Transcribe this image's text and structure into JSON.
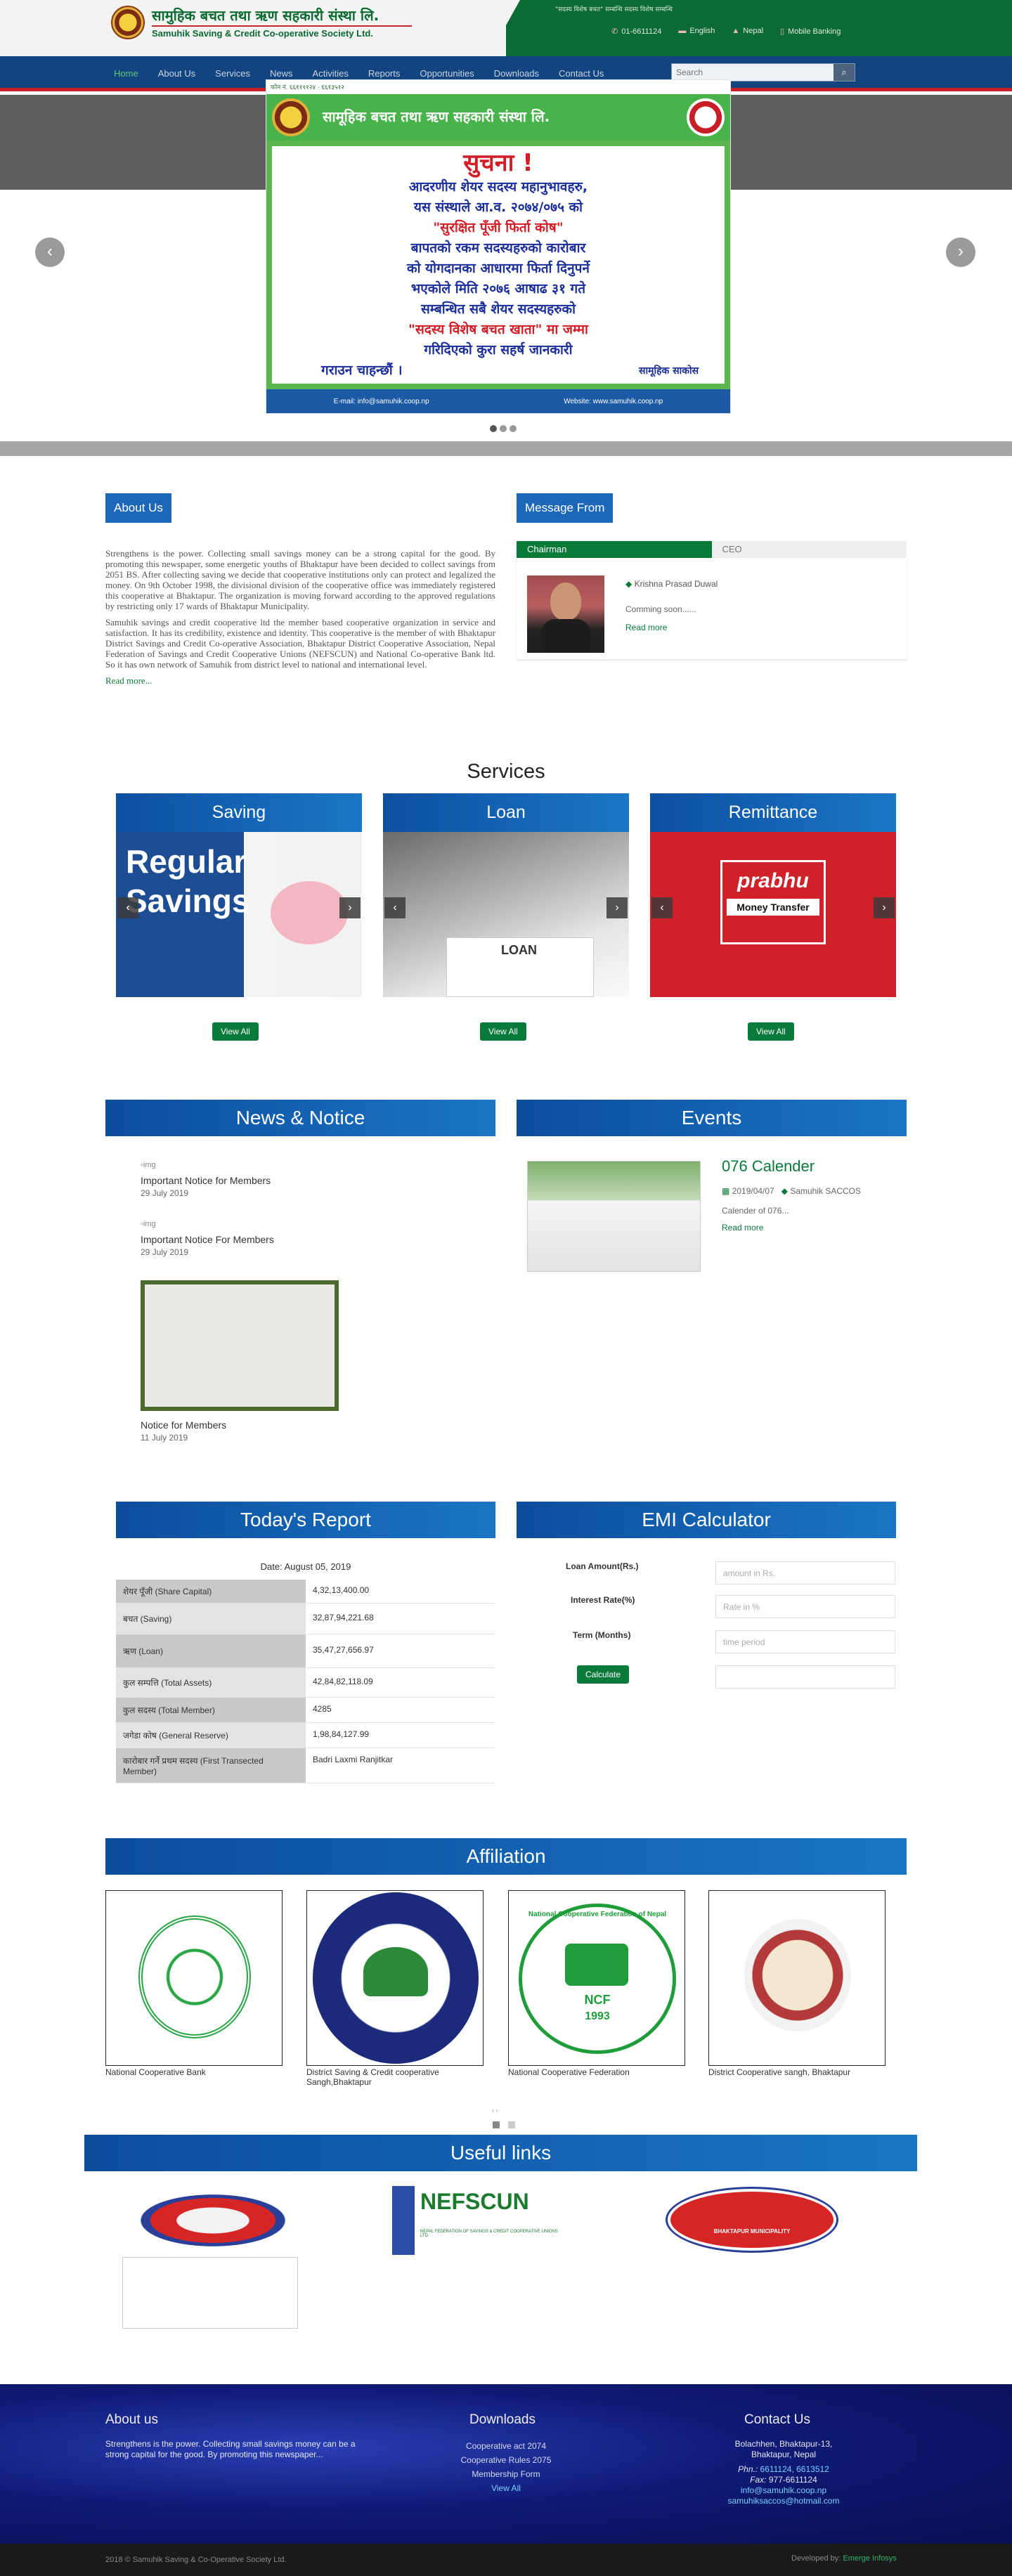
{
  "header": {
    "logo_np": "सामुहिक बचत तथा ऋण सहकारी संस्था लि.",
    "logo_en": "Samuhik Saving & Credit Co-operative Society Ltd.",
    "scroll_text": "\"सदस्य विशेष बचत\" सम्बन्धि सदस्य विशेष सम्बन्धि",
    "phone": "01-6611124",
    "language": "English",
    "nepal": "Nepal",
    "mobile_banking": "Mobile Banking"
  },
  "nav": {
    "items": [
      "Home",
      "About Us",
      "Services",
      "News",
      "Activities",
      "Reports",
      "Opportunities",
      "Downloads",
      "Contact Us"
    ],
    "search_placeholder": "Search"
  },
  "hero": {
    "notice_org": "सामूहिक बचत तथा ऋण सहकारी संस्था लि.",
    "notice_title": "सुचना !",
    "notice_lines": [
      "आदरणीय शेयर सदस्य महानुभावहरु,",
      "यस संस्थाले आ.व. २०७४/०७५ को",
      "\"सुरक्षित पूँजी फिर्ता कोष\"",
      "बापतको रकम सदस्यहरुको कारोबार",
      "को योगदानका आधारमा फिर्ता दिनुपर्ने",
      "भएकोले मिति २०७६ आषाढ ३१ गते",
      "सम्बन्धित सबै शेयर सदस्यहरुको",
      "\"सदस्य विशेष बचत खाता\" मा जम्मा",
      "गरिदिएको कुरा सहर्ष जानकारी",
      "गराउन चाहन्छौं ।"
    ],
    "notice_sign": "सामूहिक साकोस",
    "notice_email": "E-mail: info@samuhik.coop.np",
    "notice_web": "Website: www.samuhik.coop.np"
  },
  "about": {
    "title": "About Us",
    "p1": "Strengthens is the power. Collecting small savings money can be a strong capital for the good. By promoting this newspaper, some energetic youths of Bhaktapur have been decided to collect savings from 2051 BS. After collecting saving we decide that cooperative institutions only can protect and legalized the money. On 9th October 1998, the divisional division of the cooperative office was immediately registered this cooperative at Bhaktapur. The organization is moving forward according to the approved regulations by restricting only 17 wards of Bhaktapur Municipality.",
    "p2": "Samuhik savings and credit cooperative ltd the member based cooperative organization in service and satisfaction. It has its credibility, existence and identity. This cooperative is the member of with Bhaktapur District Savings and Credit Co-operative Association, Bhaktapur District Cooperative Association, Nepal Federation of Savings and Credit Cooperative Unions (NEFSCUN) and National Co-operative Bank ltd. So it has own network of Samuhik from district level to national and international level.",
    "read_more": "Read more..."
  },
  "message": {
    "title": "Message From",
    "tabs": [
      "Chairman",
      "CEO"
    ],
    "name": "Krishna Prasad Duwal",
    "text": "Comming soon......",
    "read_more": "Read more"
  },
  "services": {
    "title": "Services",
    "cards": [
      {
        "title": "Saving",
        "button": "View All",
        "img_text_1": "Regular",
        "img_text_2": "Savings"
      },
      {
        "title": "Loan",
        "button": "View All",
        "img_text_1": "LOAN",
        "img_text_2": ""
      },
      {
        "title": "Remittance",
        "button": "View All",
        "img_text_1": "prabhu",
        "img_text_2": "Money Transfer"
      }
    ]
  },
  "news": {
    "title": "News & Notice",
    "items": [
      {
        "img_alt": "img",
        "title": "Important Notice for Members",
        "date": "29 July 2019"
      },
      {
        "img_alt": "img",
        "title": "Important Notice For Members",
        "date": "29 July 2019"
      },
      {
        "img_alt": "",
        "title": "Notice for Members",
        "date": "11 July 2019"
      }
    ]
  },
  "events": {
    "title": "Events",
    "item_title": "076 Calender",
    "date": "2019/04/07",
    "author": "Samuhik SACCOS",
    "text": "Calender of 076...",
    "read_more": "Read more"
  },
  "report": {
    "title": "Today's Report",
    "date": "Date: August 05, 2019",
    "rows": [
      {
        "k": "शेयर पूँजी (Share Capital)",
        "v": "4,32,13,400.00"
      },
      {
        "k": "बचत (Saving)",
        "v": "32,87,94,221.68"
      },
      {
        "k": "ऋण (Loan)",
        "v": "35,47,27,656.97"
      },
      {
        "k": "कुल सम्पत्ति (Total Assets)",
        "v": "42,84,82,118.09"
      },
      {
        "k": "कुल सदस्य (Total Member)",
        "v": "4285"
      },
      {
        "k": "जगेडा कोष (General Reserve)",
        "v": "1,98,84,127.99"
      },
      {
        "k": "कारोबार गर्ने प्रथम सदस्य (First Transected Member)",
        "v": "Badri Laxmi Ranjitkar"
      }
    ]
  },
  "emi": {
    "title": "EMI Calculator",
    "loan_label": "Loan Amount(Rs.)",
    "loan_ph": "amount in Rs.",
    "rate_label": "Interest Rate(%)",
    "rate_ph": "Rate in %",
    "term_label": "Term (Months)",
    "term_ph": "time period",
    "button": "Calculate"
  },
  "affiliation": {
    "title": "Affiliation",
    "items": [
      {
        "label": "National Cooperative Bank"
      },
      {
        "label": "District Saving & Credit cooperative Sangh,Bhaktapur"
      },
      {
        "label": "National Cooperative Federation"
      },
      {
        "label": "District Cooperative sangh, Bhaktapur"
      }
    ],
    "ncf_text": "National Cooperative Federation of Nepal",
    "ncf_code": "NCF",
    "ncf_year": "1993"
  },
  "useful": {
    "title": "Useful links",
    "nefscun": "NEFSCUN",
    "nefscun_sub": "NEPAL FEDERATION OF SAVINGS & CREDIT COOPERATIVE UNIONS LTD.",
    "bhaktapur": "BHAKTAPUR MUNICIPALITY"
  },
  "footer": {
    "about_title": "About us",
    "about_text": "Strengthens is the power. Collecting small savings money can be a strong capital for the good. By promoting this newspaper...",
    "downloads_title": "Downloads",
    "downloads": [
      "Cooperative act 2074",
      "Cooperative Rules 2075",
      "Membership Form"
    ],
    "view_all": "View All",
    "contact_title": "Contact Us",
    "address1": "Bolachhen, Bhaktapur-13,",
    "address2": "Bhaktapur, Nepal",
    "phone_label": "Phn.:",
    "phone": "6611124, 6613512",
    "fax_label": "Fax:",
    "fax": "977-6611124",
    "email1": "info@samuhik.coop.np",
    "email2": "samuhiksaccos@hotmail.com",
    "copyright": "2018 © Samuhik Saving & Co-Operative Society Ltd.",
    "developed_by": "Developed by:",
    "developer": "Emerge Infosys"
  },
  "colors": {
    "nav": "#12457f",
    "accent_green": "#0a7a3a",
    "blue_head": "#1c67b8",
    "red_line": "#c81f26"
  }
}
